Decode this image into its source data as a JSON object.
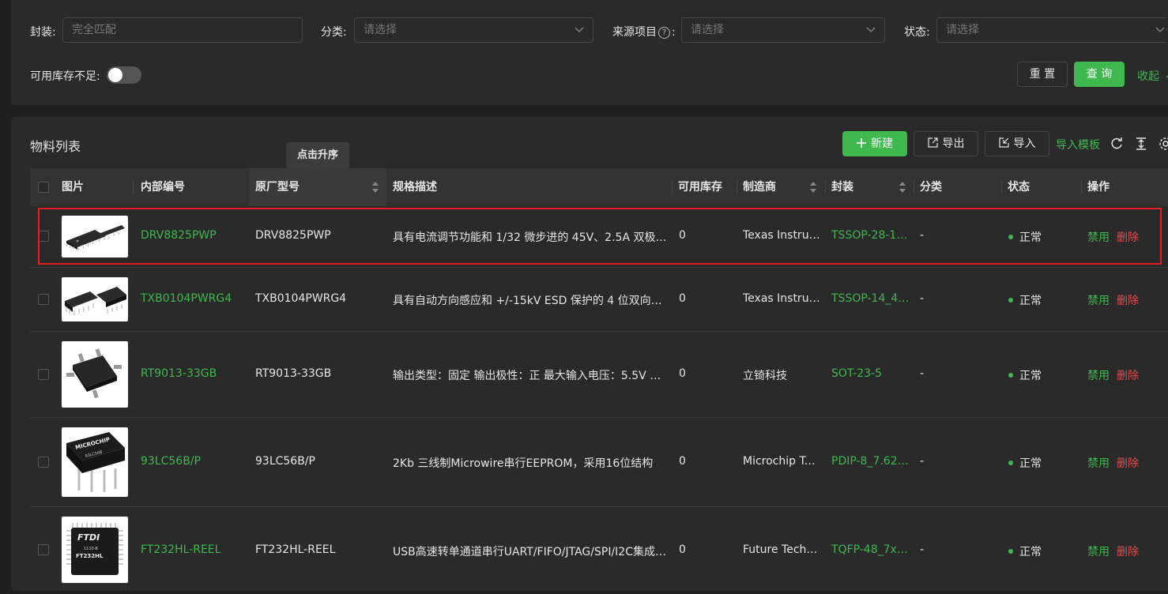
{
  "filters": {
    "package_label": "封装:",
    "package_placeholder": "完全匹配",
    "category_label": "分类:",
    "category_placeholder": "请选择",
    "source_label": "来源项目",
    "source_help": "?",
    "source_colon": ":",
    "source_placeholder": "请选择",
    "status_label": "状态:",
    "status_placeholder": "请选择",
    "low_stock_label": "可用库存不足:",
    "reset_label": "重 置",
    "query_label": "查 询",
    "collapse_label": "收起"
  },
  "list": {
    "title": "物料列表",
    "new_label": "新建",
    "export_label": "导出",
    "import_label": "导入",
    "import_template_label": "导入模板",
    "tooltip": "点击升序"
  },
  "columns": {
    "image": "图片",
    "internal_code": "内部编号",
    "mfr_part": "原厂型号",
    "spec": "规格描述",
    "stock": "可用库存",
    "manufacturer": "制造商",
    "package": "封装",
    "category": "分类",
    "status": "状态",
    "actions": "操作"
  },
  "rows": [
    {
      "internal_code": "DRV8825PWP",
      "mfr_part": "DRV8825PWP",
      "spec": "具有电流调节功能和 1/32 微步进的 45V、2.5A 双极步…",
      "stock": "0",
      "manufacturer": "Texas Instrum…",
      "package": "TSSOP-28-1E…",
      "category": "-",
      "status": "正常",
      "disable": "禁用",
      "delete": "删除",
      "image_icon": "chip-tssop-28-icon"
    },
    {
      "internal_code": "TXB0104PWRG4",
      "mfr_part": "TXB0104PWRG4",
      "spec": "具有自动方向感应和 +/-15kV ESD 保护的 4 位双向电…",
      "stock": "0",
      "manufacturer": "Texas Instrum…",
      "package": "TSSOP-14_4.4…",
      "category": "-",
      "status": "正常",
      "disable": "禁用",
      "delete": "删除",
      "image_icon": "chip-tssop-14-icon"
    },
    {
      "internal_code": "RT9013-33GB",
      "mfr_part": "RT9013-33GB",
      "spec": "输出类型：固定 输出极性：正 最大输入电压：5.5V 输…",
      "stock": "0",
      "manufacturer": "立锜科技",
      "package": "SOT-23-5",
      "category": "-",
      "status": "正常",
      "disable": "禁用",
      "delete": "删除",
      "image_icon": "chip-sot23-icon"
    },
    {
      "internal_code": "93LC56B/P",
      "mfr_part": "93LC56B/P",
      "spec": "2Kb 三线制Microwire串行EEPROM，采用16位结构",
      "stock": "0",
      "manufacturer": "Microchip Tec…",
      "package": "PDIP-8_7.62x…",
      "category": "-",
      "status": "正常",
      "disable": "禁用",
      "delete": "删除",
      "image_icon": "chip-pdip-icon",
      "chip_brand": "MICROCHIP",
      "chip_text": "93LC56B"
    },
    {
      "internal_code": "FT232HL-REEL",
      "mfr_part": "FT232HL-REEL",
      "spec": "USB高速转单通道串行UART/FIFO/JTAG/SPI/I2C集成电…",
      "stock": "0",
      "manufacturer": "Future Techn…",
      "package": "TQFP-48_7x7…",
      "category": "-",
      "status": "正常",
      "disable": "禁用",
      "delete": "删除",
      "image_icon": "chip-tqfp-icon",
      "chip_brand": "FTDI",
      "chip_text": "FT232HL",
      "chip_sub": "1110-B"
    }
  ],
  "colors": {
    "accent": "#3fb850",
    "danger": "#e24c4c",
    "highlight": "#e02020"
  }
}
